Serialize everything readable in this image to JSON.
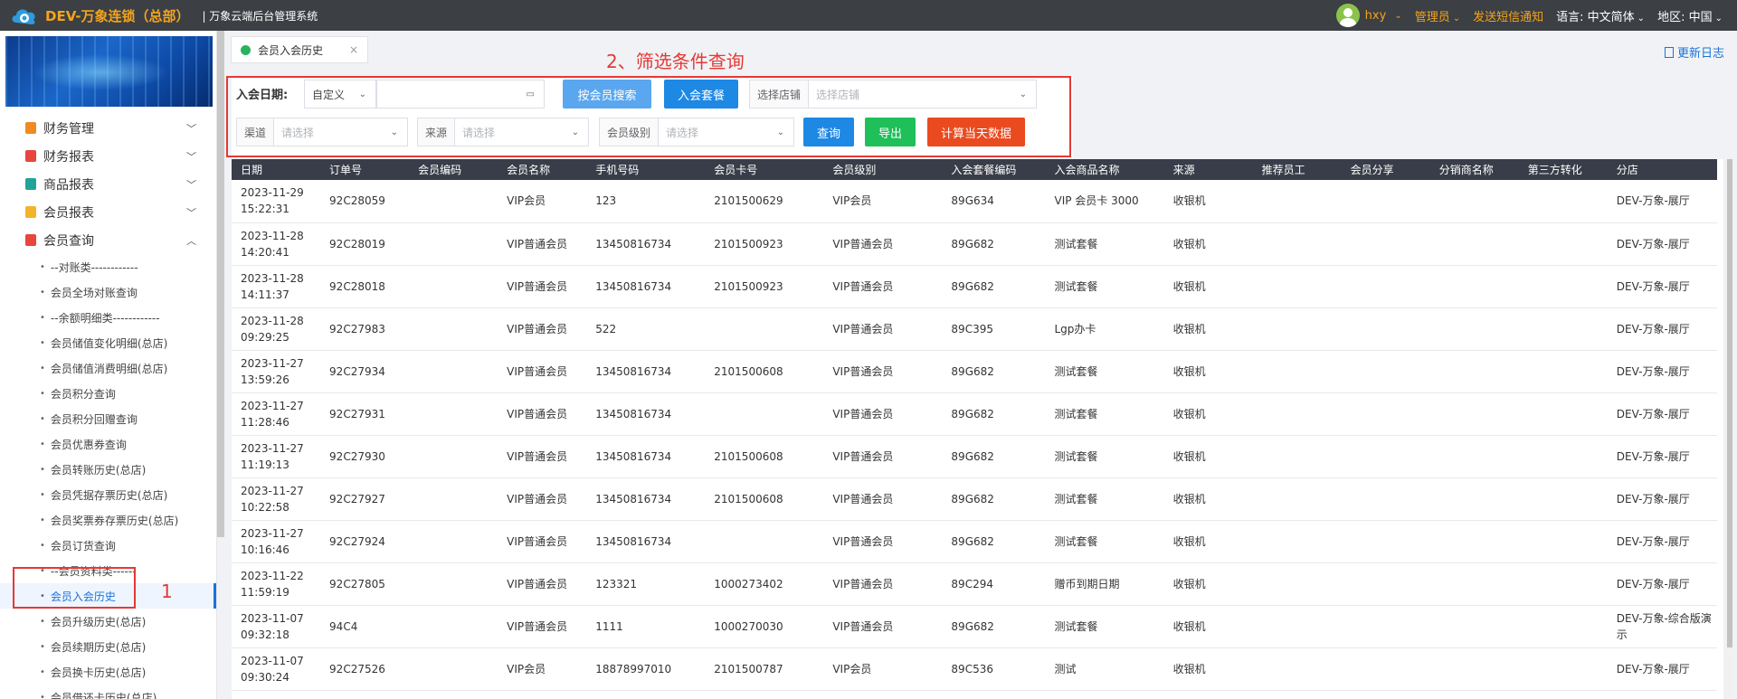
{
  "topbar": {
    "brand": "DEV-万象连锁（总部）",
    "subtitle": "| 万象云端后台管理系统",
    "user": "hxy",
    "role": "管理员",
    "sms": "发送短信通知",
    "language_label": "语言:",
    "language_value": "中文简体",
    "region_label": "地区:",
    "region_value": "中国"
  },
  "sidebar": {
    "groups": [
      {
        "label": "财务管理",
        "color": "#f08a24"
      },
      {
        "label": "财务报表",
        "color": "#e8453c"
      },
      {
        "label": "商品报表",
        "color": "#21a39a"
      },
      {
        "label": "会员报表",
        "color": "#f3b42b"
      },
      {
        "label": "会员查询",
        "color": "#e8453c"
      }
    ],
    "items": [
      "--对账类------------",
      "会员全场对账查询",
      "--余额明细类------------",
      "会员储值变化明细(总店)",
      "会员储值消费明细(总店)",
      "会员积分查询",
      "会员积分回赠查询",
      "会员优惠券查询",
      "会员转账历史(总店)",
      "会员凭据存票历史(总店)",
      "会员奖票券存票历史(总店)",
      "会员订货查询",
      "--会员资料类------",
      "会员入会历史",
      "会员升级历史(总店)",
      "会员续期历史(总店)",
      "会员换卡历史(总店)",
      "会员借还卡历史(总店)"
    ],
    "annotation_number": "1"
  },
  "tabs": {
    "active_tab": "会员入会历史",
    "close": "×",
    "update_log": "更新日志"
  },
  "annotation_title": "2、筛选条件查询",
  "filter": {
    "join_date_label": "入会日期:",
    "date_mode": "自定义",
    "search_by_member": "按会员搜索",
    "join_package": "入会套餐",
    "store_label": "选择店铺",
    "store_placeholder": "选择店铺",
    "channel_label": "渠道",
    "channel_placeholder": "请选择",
    "source_label": "来源",
    "source_placeholder": "请选择",
    "level_label": "会员级别",
    "level_placeholder": "请选择",
    "query": "查询",
    "export": "导出",
    "calc_today": "计算当天数据"
  },
  "table": {
    "columns": [
      "日期",
      "订单号",
      "会员编码",
      "会员名称",
      "手机号码",
      "会员卡号",
      "会员级别",
      "入会套餐编码",
      "入会商品名称",
      "来源",
      "推荐员工",
      "会员分享",
      "分销商名称",
      "第三方转化",
      "分店"
    ],
    "rows": [
      [
        "2023-11-29 15:22:31",
        "92C28059",
        "",
        "VIP会员",
        "123",
        "2101500629",
        "VIP会员",
        "89G634",
        "VIP 会员卡 3000",
        "收银机",
        "",
        "",
        "",
        "",
        "DEV-万象-展厅"
      ],
      [
        "2023-11-28 14:20:41",
        "92C28019",
        "",
        "VIP普通会员",
        "13450816734",
        "2101500923",
        "VIP普通会员",
        "89G682",
        "测试套餐",
        "收银机",
        "",
        "",
        "",
        "",
        "DEV-万象-展厅"
      ],
      [
        "2023-11-28 14:11:37",
        "92C28018",
        "",
        "VIP普通会员",
        "13450816734",
        "2101500923",
        "VIP普通会员",
        "89G682",
        "测试套餐",
        "收银机",
        "",
        "",
        "",
        "",
        "DEV-万象-展厅"
      ],
      [
        "2023-11-28 09:29:25",
        "92C27983",
        "",
        "VIP普通会员",
        "522",
        "",
        "VIP普通会员",
        "89C395",
        "Lgp办卡",
        "收银机",
        "",
        "",
        "",
        "",
        "DEV-万象-展厅"
      ],
      [
        "2023-11-27 13:59:26",
        "92C27934",
        "",
        "VIP普通会员",
        "13450816734",
        "2101500608",
        "VIP普通会员",
        "89G682",
        "测试套餐",
        "收银机",
        "",
        "",
        "",
        "",
        "DEV-万象-展厅"
      ],
      [
        "2023-11-27 11:28:46",
        "92C27931",
        "",
        "VIP普通会员",
        "13450816734",
        "",
        "VIP普通会员",
        "89G682",
        "测试套餐",
        "收银机",
        "",
        "",
        "",
        "",
        "DEV-万象-展厅"
      ],
      [
        "2023-11-27 11:19:13",
        "92C27930",
        "",
        "VIP普通会员",
        "13450816734",
        "2101500608",
        "VIP普通会员",
        "89G682",
        "测试套餐",
        "收银机",
        "",
        "",
        "",
        "",
        "DEV-万象-展厅"
      ],
      [
        "2023-11-27 10:22:58",
        "92C27927",
        "",
        "VIP普通会员",
        "13450816734",
        "2101500608",
        "VIP普通会员",
        "89G682",
        "测试套餐",
        "收银机",
        "",
        "",
        "",
        "",
        "DEV-万象-展厅"
      ],
      [
        "2023-11-27 10:16:46",
        "92C27924",
        "",
        "VIP普通会员",
        "13450816734",
        "",
        "VIP普通会员",
        "89G682",
        "测试套餐",
        "收银机",
        "",
        "",
        "",
        "",
        "DEV-万象-展厅"
      ],
      [
        "2023-11-22 11:59:19",
        "92C27805",
        "",
        "VIP普通会员",
        "123321",
        "1000273402",
        "VIP普通会员",
        "89C294",
        "赠币到期日期",
        "收银机",
        "",
        "",
        "",
        "",
        "DEV-万象-展厅"
      ],
      [
        "2023-11-07 09:32:18",
        "94C4",
        "",
        "VIP普通会员",
        "1111",
        "1000270030",
        "VIP普通会员",
        "89G682",
        "测试套餐",
        "收银机",
        "",
        "",
        "",
        "",
        "DEV-万象-综合版演示"
      ],
      [
        "2023-11-07 09:30:24",
        "92C27526",
        "",
        "VIP会员",
        "18878997010",
        "2101500787",
        "VIP会员",
        "89C536",
        "测试",
        "收银机",
        "",
        "",
        "",
        "",
        "DEV-万象-展厅"
      ]
    ]
  }
}
